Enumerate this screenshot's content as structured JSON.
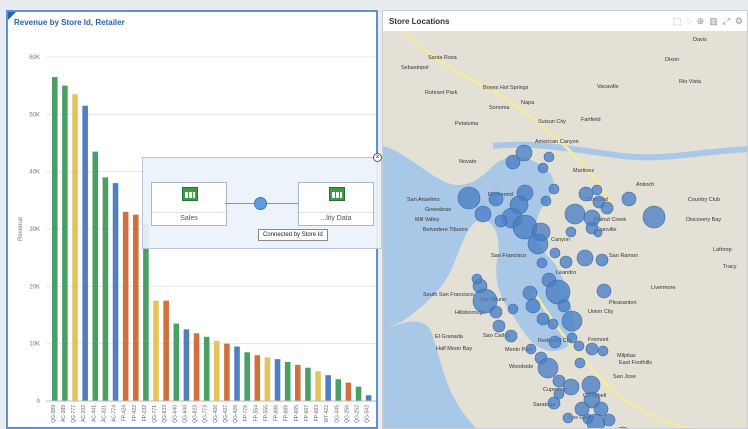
{
  "left_panel": {
    "title": "Revenue by Store Id, Retailer"
  },
  "right_panel": {
    "title": "Store Locations",
    "toolbar_icons": [
      "select-icon",
      "lasso-icon",
      "zoom-icon",
      "bar-chart-icon",
      "expand-icon",
      "gear-icon"
    ]
  },
  "connection": {
    "source_label": "Sales",
    "target_label": "...lity Data",
    "tooltip": "Connected by Store Id"
  },
  "chart_data": {
    "type": "bar",
    "title": "Revenue by Store Id, Retailer",
    "ylabel": "Revenue",
    "xlabel": "",
    "ylim": [
      0,
      60000
    ],
    "yticks": [
      "0",
      "10K",
      "20K",
      "30K",
      "40K",
      "50K",
      "60K"
    ],
    "grid": true,
    "categories": [
      "QG-389",
      "AC-389",
      "QG-777",
      "AC-332",
      "AC-441",
      "AC-321",
      "AC-774",
      "FP-424",
      "FP-422",
      "FP-232",
      "QG-771",
      "QG-833",
      "QG-640",
      "QG-640",
      "QG-823",
      "QG-773",
      "QG-426",
      "QG-427",
      "QG-428",
      "FP-778",
      "FP-554",
      "FP-555",
      "FP-686",
      "FP-689",
      "FP-665",
      "FP-667",
      "FP-683",
      "WT-422",
      "QG-345",
      "QG-256",
      "QG-252",
      "QG-542"
    ],
    "values": [
      56500,
      55000,
      53500,
      51500,
      43500,
      39000,
      38000,
      33000,
      32500,
      31000,
      17500,
      17500,
      13500,
      12500,
      11800,
      11200,
      10500,
      10000,
      9500,
      8500,
      8000,
      7600,
      7300,
      6800,
      6300,
      5800,
      5200,
      4500,
      3800,
      3200,
      2500,
      1000
    ],
    "colors": [
      "#4aa064",
      "#4aa064",
      "#e2c45a",
      "#4f7fc1",
      "#4aa064",
      "#4aa064",
      "#4f7fc1",
      "#d0703c",
      "#d0703c",
      "#4aa064",
      "#e2c45a",
      "#d0703c",
      "#4aa064",
      "#4f7fc1",
      "#d0703c",
      "#4aa064",
      "#e2c45a",
      "#d0703c",
      "#4f7fc1",
      "#4aa064",
      "#d0703c",
      "#e2c45a",
      "#4f7fc1",
      "#4aa064",
      "#d0703c",
      "#4aa064",
      "#e2c45a",
      "#4f7fc1",
      "#4aa064",
      "#d0703c",
      "#4aa064",
      "#4f7fc1"
    ]
  },
  "map": {
    "place_labels": [
      {
        "name": "Santa Rosa",
        "x": 45,
        "y": 28
      },
      {
        "name": "Sebastopol",
        "x": 18,
        "y": 38
      },
      {
        "name": "Rohnert Park",
        "x": 42,
        "y": 63
      },
      {
        "name": "Boyes Hot Springs",
        "x": 100,
        "y": 58
      },
      {
        "name": "Vacaville",
        "x": 214,
        "y": 57
      },
      {
        "name": "Dixon",
        "x": 282,
        "y": 30
      },
      {
        "name": "Davis",
        "x": 310,
        "y": 10
      },
      {
        "name": "Sonoma",
        "x": 106,
        "y": 78
      },
      {
        "name": "Napa",
        "x": 138,
        "y": 73
      },
      {
        "name": "Suisun City",
        "x": 155,
        "y": 92
      },
      {
        "name": "Fairfield",
        "x": 198,
        "y": 90
      },
      {
        "name": "Petaluma",
        "x": 72,
        "y": 94
      },
      {
        "name": "Rio Vista",
        "x": 296,
        "y": 52
      },
      {
        "name": "American Canyon",
        "x": 152,
        "y": 112
      },
      {
        "name": "Novato",
        "x": 76,
        "y": 132
      },
      {
        "name": "Martinez",
        "x": 190,
        "y": 141
      },
      {
        "name": "Antioch",
        "x": 253,
        "y": 155
      },
      {
        "name": "San Anselmo",
        "x": 24,
        "y": 170
      },
      {
        "name": "Greenbrae",
        "x": 42,
        "y": 180
      },
      {
        "name": "Mill Valley",
        "x": 32,
        "y": 190
      },
      {
        "name": "Belvedere Tiburon",
        "x": 40,
        "y": 200
      },
      {
        "name": "Country Club",
        "x": 305,
        "y": 170
      },
      {
        "name": "Discovery Bay",
        "x": 303,
        "y": 190
      },
      {
        "name": "Richmond",
        "x": 105,
        "y": 165
      },
      {
        "name": "Walnut Creek",
        "x": 210,
        "y": 190
      },
      {
        "name": "Lathrop",
        "x": 330,
        "y": 220
      },
      {
        "name": "San Francisco",
        "x": 108,
        "y": 226
      },
      {
        "name": "San Ramon",
        "x": 226,
        "y": 226
      },
      {
        "name": "Tracy",
        "x": 340,
        "y": 237
      },
      {
        "name": "Livermore",
        "x": 268,
        "y": 258
      },
      {
        "name": "South San Francisco",
        "x": 40,
        "y": 265
      },
      {
        "name": "Pleasanton",
        "x": 226,
        "y": 273
      },
      {
        "name": "Union City",
        "x": 205,
        "y": 282
      },
      {
        "name": "Hillsborough",
        "x": 72,
        "y": 283
      },
      {
        "name": "San Bruno",
        "x": 97,
        "y": 270
      },
      {
        "name": "El Granada",
        "x": 52,
        "y": 307
      },
      {
        "name": "Half Moon Bay",
        "x": 53,
        "y": 319
      },
      {
        "name": "San Carlos",
        "x": 100,
        "y": 306
      },
      {
        "name": "Redwood City",
        "x": 155,
        "y": 311
      },
      {
        "name": "Fremont",
        "x": 205,
        "y": 310
      },
      {
        "name": "Menlo Park",
        "x": 122,
        "y": 320
      },
      {
        "name": "Woodside",
        "x": 126,
        "y": 337
      },
      {
        "name": "Milpitas",
        "x": 234,
        "y": 326
      },
      {
        "name": "East Foothills",
        "x": 236,
        "y": 333
      },
      {
        "name": "San Jose",
        "x": 230,
        "y": 347
      },
      {
        "name": "Cupertino",
        "x": 160,
        "y": 360
      },
      {
        "name": "Saratoga",
        "x": 150,
        "y": 375
      },
      {
        "name": "Campbell",
        "x": 200,
        "y": 366
      },
      {
        "name": "Los Gatos",
        "x": 186,
        "y": 388
      },
      {
        "name": "Concord",
        "x": 204,
        "y": 170
      },
      {
        "name": "Danville",
        "x": 214,
        "y": 200
      },
      {
        "name": "Canyon",
        "x": 168,
        "y": 210
      },
      {
        "name": "Leandro",
        "x": 173,
        "y": 243
      }
    ],
    "bubbles": [
      [
        130,
        131,
        7
      ],
      [
        141,
        122,
        8
      ],
      [
        166,
        126,
        5
      ],
      [
        160,
        137,
        5
      ],
      [
        86,
        167,
        11
      ],
      [
        113,
        168,
        7
      ],
      [
        142,
        162,
        8
      ],
      [
        136,
        174,
        9
      ],
      [
        129,
        187,
        10
      ],
      [
        163,
        170,
        5
      ],
      [
        171,
        158,
        5
      ],
      [
        203,
        163,
        7
      ],
      [
        214,
        159,
        5
      ],
      [
        216,
        171,
        6
      ],
      [
        224,
        177,
        6
      ],
      [
        246,
        168,
        7
      ],
      [
        192,
        183,
        10
      ],
      [
        209,
        187,
        8
      ],
      [
        209,
        197,
        6
      ],
      [
        188,
        201,
        5
      ],
      [
        215,
        202,
        4
      ],
      [
        271,
        186,
        11
      ],
      [
        100,
        183,
        8
      ],
      [
        118,
        190,
        6
      ],
      [
        142,
        196,
        12
      ],
      [
        158,
        201,
        9
      ],
      [
        155,
        213,
        10
      ],
      [
        159,
        232,
        5
      ],
      [
        172,
        222,
        5
      ],
      [
        183,
        231,
        6
      ],
      [
        202,
        227,
        8
      ],
      [
        219,
        229,
        6
      ],
      [
        97,
        255,
        7
      ],
      [
        102,
        270,
        12
      ],
      [
        113,
        281,
        6
      ],
      [
        94,
        248,
        5
      ],
      [
        166,
        249,
        7
      ],
      [
        147,
        262,
        7
      ],
      [
        175,
        261,
        12
      ],
      [
        181,
        275,
        6
      ],
      [
        189,
        290,
        10
      ],
      [
        150,
        275,
        7
      ],
      [
        160,
        288,
        6
      ],
      [
        170,
        293,
        5
      ],
      [
        130,
        278,
        5
      ],
      [
        116,
        295,
        6
      ],
      [
        128,
        305,
        6
      ],
      [
        172,
        311,
        6
      ],
      [
        148,
        318,
        5
      ],
      [
        221,
        260,
        7
      ],
      [
        189,
        307,
        5
      ],
      [
        196,
        315,
        5
      ],
      [
        209,
        318,
        6
      ],
      [
        220,
        320,
        5
      ],
      [
        197,
        332,
        5
      ],
      [
        158,
        327,
        6
      ],
      [
        165,
        337,
        10
      ],
      [
        176,
        350,
        6
      ],
      [
        188,
        356,
        8
      ],
      [
        176,
        363,
        5
      ],
      [
        171,
        372,
        6
      ],
      [
        208,
        354,
        9
      ],
      [
        209,
        369,
        8
      ],
      [
        199,
        378,
        7
      ],
      [
        218,
        378,
        7
      ],
      [
        205,
        388,
        5
      ],
      [
        213,
        392,
        9
      ],
      [
        240,
        405,
        9
      ],
      [
        226,
        389,
        6
      ],
      [
        185,
        387,
        5
      ]
    ]
  }
}
